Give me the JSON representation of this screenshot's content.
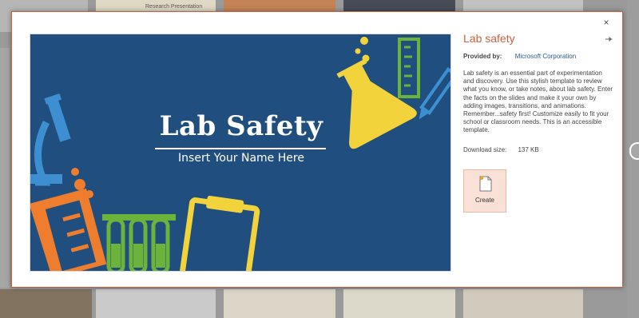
{
  "background": {
    "top_thumb_label": "Research Presentation"
  },
  "modal": {
    "close_glyph": "×",
    "pin_icon": "pin-icon"
  },
  "slide": {
    "title": "Lab Safety",
    "subtitle": "Insert Your Name Here",
    "colors": {
      "background": "#1f4e7f",
      "yellow": "#f2d33b",
      "orange": "#ef7d2e",
      "green": "#6bb33a",
      "blue": "#3d8fd1"
    }
  },
  "details": {
    "title": "Lab safety",
    "provided_label": "Provided by:",
    "provider": "Microsoft Corporation",
    "description": "Lab safety is an essential part of experimentation and discovery. Use this stylish template to review what you know, or take notes, about lab safety. Enter the facts on the slides and make it your own by adding images, transitions, and animations. Remember...safety first! Customize easily to fit your school or classroom needs. This is an accessible template.",
    "download_label": "Download size:",
    "download_value": "137 KB"
  },
  "actions": {
    "create_label": "Create",
    "create_icon": "new-document-icon"
  },
  "accent_color": "#c95f3c"
}
